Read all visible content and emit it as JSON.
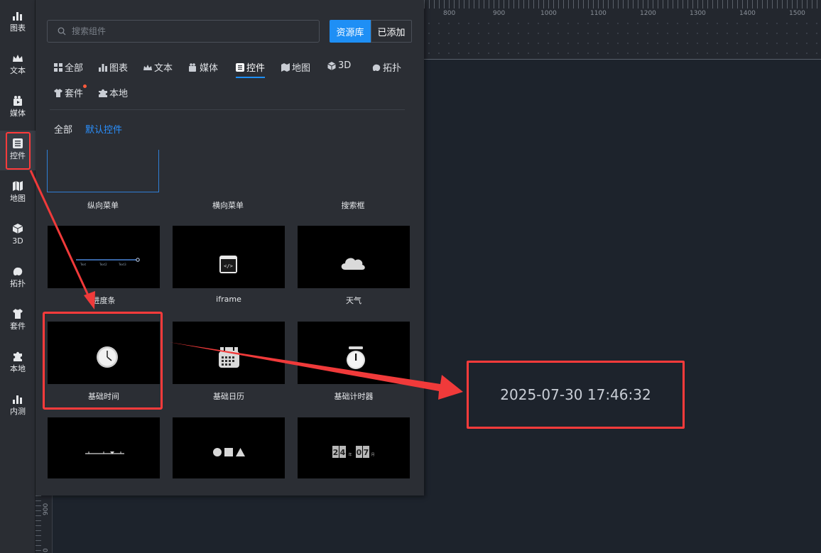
{
  "sidebar": {
    "items": [
      {
        "label": "图表",
        "icon": "bar-chart-icon"
      },
      {
        "label": "文本",
        "icon": "crown-icon"
      },
      {
        "label": "媒体",
        "icon": "media-icon"
      },
      {
        "label": "控件",
        "icon": "list-icon",
        "active": true
      },
      {
        "label": "地图",
        "icon": "map-icon"
      },
      {
        "label": "3D",
        "icon": "cube-icon"
      },
      {
        "label": "拓扑",
        "icon": "topology-icon"
      },
      {
        "label": "套件",
        "icon": "shirt-icon"
      },
      {
        "label": "本地",
        "icon": "puzzle-icon"
      },
      {
        "label": "内测",
        "icon": "bar-chart-icon"
      }
    ]
  },
  "ruler": {
    "top_numbers": [
      "800",
      "900",
      "1000",
      "1100",
      "1200",
      "1300",
      "1400",
      "1500"
    ],
    "left_numbers": [
      "900",
      "0"
    ]
  },
  "panel": {
    "search_placeholder": "搜索组件",
    "tab_library": "资源库",
    "tab_added": "已添加",
    "categories": [
      {
        "label": "全部",
        "icon": "grid-icon"
      },
      {
        "label": "图表",
        "icon": "bar-chart-icon"
      },
      {
        "label": "文本",
        "icon": "crown-icon"
      },
      {
        "label": "媒体",
        "icon": "media-icon"
      },
      {
        "label": "控件",
        "icon": "list-icon",
        "active": true
      },
      {
        "label": "地图",
        "icon": "map-icon"
      },
      {
        "label": "3D",
        "icon": "cube-icon"
      },
      {
        "label": "拓扑",
        "icon": "topology-icon"
      },
      {
        "label": "套件",
        "icon": "shirt-icon",
        "badge": true
      },
      {
        "label": "本地",
        "icon": "puzzle-icon"
      }
    ],
    "subfilters": [
      {
        "label": "全部",
        "active": false
      },
      {
        "label": "默认控件",
        "active": true
      }
    ],
    "cards": [
      {
        "name": "纵向菜单",
        "icon": "vertical-menu-thumb"
      },
      {
        "name": "横向菜单",
        "icon": "horizontal-menu-thumb"
      },
      {
        "name": "搜索框",
        "icon": "search-box-thumb"
      },
      {
        "name": "进度条",
        "icon": "progress-bar-thumb"
      },
      {
        "name": "iframe",
        "icon": "code-window-icon"
      },
      {
        "name": "天气",
        "icon": "cloud-icon"
      },
      {
        "name": "基础时间",
        "icon": "clock-icon",
        "highlighted": true
      },
      {
        "name": "基础日历",
        "icon": "calendar-icon"
      },
      {
        "name": "基础计时器",
        "icon": "stopwatch-icon"
      },
      {
        "name": "",
        "icon": "timeline-thumb"
      },
      {
        "name": "",
        "icon": "shapes-thumb"
      },
      {
        "name": "",
        "icon": "flip-clock-thumb"
      }
    ],
    "progress_thumb_labels": [
      "Text",
      "Text2",
      "Text3"
    ],
    "flip_clock_digits": [
      "2",
      "4",
      "0",
      "7"
    ],
    "flip_clock_units": [
      "年",
      "月"
    ]
  },
  "canvas": {
    "time_display": "2025-07-30 17:46:32"
  },
  "colors": {
    "accent": "#1e8ff5",
    "highlight": "#ff3b3b",
    "panel_bg": "#2b2e34",
    "canvas_bg": "#1d232c"
  }
}
